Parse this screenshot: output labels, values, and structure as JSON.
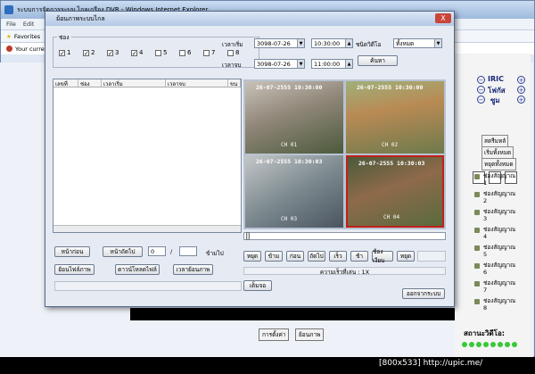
{
  "browser": {
    "title": "ระบบการจัดการระบบ ไกลเกรือง DVR - Windows Internet Explorer",
    "menu": [
      "File",
      "Edit"
    ],
    "favorites_label": "Favorites",
    "warning_text": "Your curre"
  },
  "dialog": {
    "title": "ย้อนภาพระบบไกล",
    "close_label": "X",
    "channel_legend": "ช่อง",
    "channels": [
      {
        "label": "1",
        "checked": true
      },
      {
        "label": "2",
        "checked": true
      },
      {
        "label": "3",
        "checked": true
      },
      {
        "label": "4",
        "checked": true
      },
      {
        "label": "5",
        "checked": false
      },
      {
        "label": "6",
        "checked": false
      },
      {
        "label": "7",
        "checked": false
      },
      {
        "label": "8",
        "checked": false
      }
    ],
    "start_label": "เวลาเริ่ม",
    "end_label": "เวลาจบ",
    "start_date": "3098-07-26",
    "start_time": "10:30:00",
    "end_date": "3098-07-26",
    "end_time": "11:00:00",
    "type_label": "ชนิดวิดีโอ",
    "type_value": "ทั้งหมด",
    "search_button": "ค้นหา",
    "list_columns": [
      "เลขที่",
      "ช่อง",
      "เวลาเริ่ม",
      "เวลาจบ",
      "ขน"
    ],
    "prev_page": "หน้าก่อน",
    "next_page": "หน้าถัดไป",
    "page_current": "0",
    "page_separator": "/",
    "page_total": "",
    "goto_label": "ข้ามไป",
    "local_file_button": "ย้อนไฟล์ภาพ",
    "download_button": "ดาวน์โหลดไฟล์",
    "time_playback_button": "เวลาย้อนภาพ",
    "cameras": [
      {
        "timestamp": "26-07-2555 10:30:00",
        "id": "CH 01"
      },
      {
        "timestamp": "26-07-2555 10:30:00",
        "id": "CH 02"
      },
      {
        "timestamp": "26-07-2555 10:30:03",
        "id": "CH 03"
      },
      {
        "timestamp": "26-07-2555 10:30:03",
        "id": "CH 04"
      }
    ],
    "controls": [
      "หยุด",
      "ข้าม",
      "ก่อน",
      "ถัดไป",
      "เร็ว",
      "ช้า",
      "ช้องเงียบ",
      "หยุด"
    ],
    "speed_text": "ความเร็วที่เล่น : 1X",
    "fullscreen_button": "เต็มจอ",
    "exit_button": "ออกจากระบบ"
  },
  "right_panel": {
    "iris_label": "IRIC",
    "focus_label": "โฟกัส",
    "zoom_label": "ซูม",
    "select_label": "สตรีมหลั",
    "start_all": "เริ่มทั้งหมด",
    "stop_all": "หยุดทั้งหมด",
    "channels": [
      {
        "name": "ช่องสัญญาณ",
        "num": "1"
      },
      {
        "name": "ช่องสัญญาณ",
        "num": "2"
      },
      {
        "name": "ช่องสัญญาณ",
        "num": "3"
      },
      {
        "name": "ช่องสัญญาณ",
        "num": "4"
      },
      {
        "name": "ช่องสัญญาณ",
        "num": "5"
      },
      {
        "name": "ช่องสัญญาณ",
        "num": "6"
      },
      {
        "name": "ช่องสัญญาณ",
        "num": "7"
      },
      {
        "name": "ช่องสัญญาณ",
        "num": "8"
      }
    ],
    "status_label": "สถานะวิดีโอ:"
  },
  "page_bottom": {
    "settings_button": "การตั้งค่า",
    "playback_button": "ย้อนภาพ"
  },
  "watermark": "[800x533] http://upic.me/"
}
